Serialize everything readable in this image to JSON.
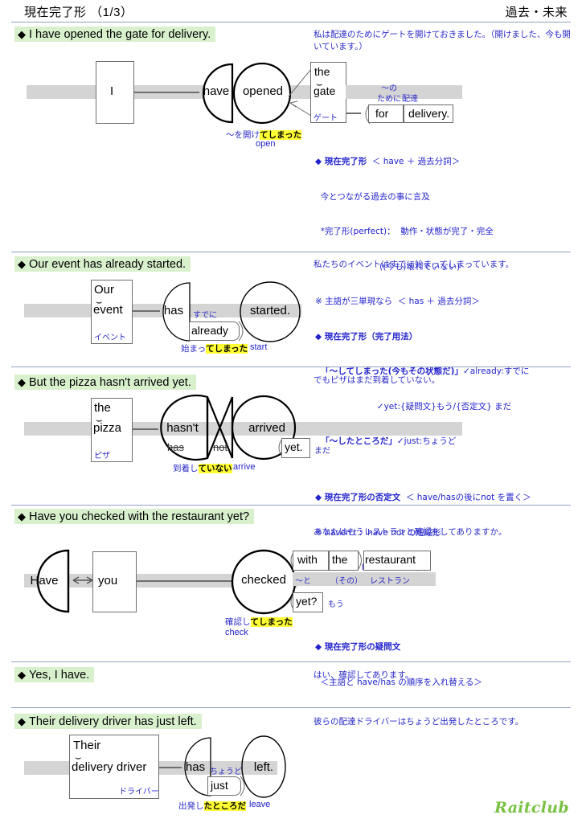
{
  "header": {
    "title": "現在完了形 （1/3）",
    "right": "過去・未来"
  },
  "logo": "Raitclub",
  "sections": [
    {
      "id": "s1",
      "heading": "I have opened the gate for delivery.",
      "diamond": "◆",
      "translation": "私は配達のためにゲートを開けておきました。（開けました、今も開いています。）",
      "diagram": {
        "subject": "I",
        "verb_aux": "have",
        "verb_main": "opened",
        "object_det": "the",
        "object_noun": "gate",
        "object_jp": "ゲート",
        "prep": "for",
        "prep_obj": "delivery.",
        "prep_jp_1": "〜の",
        "prep_jp_2": "ために",
        "prep_jp_3": "配達",
        "ann_jp_plain": "〜を開け",
        "ann_jp_hl": "てしまった",
        "ann_en": "open"
      },
      "explain": [
        {
          "bold": "◆ 現在完了形",
          "rest": "  ＜ have ＋ 過去分詞＞"
        },
        {
          "bold": "",
          "rest": "  今とつながる過去の事に言及"
        },
        {
          "bold": "",
          "rest": "  *完了形(perfect)：  動作・状態が完了・完全"
        },
        {
          "bold": "",
          "rest": "                        ((今も)壊れていない)"
        },
        {
          "bold": "",
          "rest": "※ 主語が三単現なら  ＜ has ＋ 過去分詞＞"
        },
        {
          "bold": "◆ 現在完了形（完了用法）",
          "rest": ""
        },
        {
          "bold": "  「〜してしまった(今もその状態だ)」",
          "rest": "✓already:すでに"
        },
        {
          "bold": "",
          "rest": "                       ✓yet:{疑問文}もう/{否定文} まだ"
        },
        {
          "bold": "  「〜したところだ」",
          "rest": "✓just:ちょうど"
        }
      ]
    },
    {
      "id": "s2",
      "heading": "Our event has already started.",
      "diamond": "◆",
      "translation": "私たちのイベントはすでに始まってしまっています。",
      "diagram": {
        "subject_det": "Our",
        "subject_noun": "event",
        "subject_jp": "イベント",
        "verb_aux": "has",
        "adverb": "already",
        "adverb_jp": "すでに",
        "verb_main": "started.",
        "ann_jp_plain": "始まっ",
        "ann_jp_hl": "てしまった",
        "ann_en": "start"
      },
      "explain": []
    },
    {
      "id": "s3",
      "heading": "But the pizza hasn't arrived yet.",
      "diamond": "◆",
      "translation": "でもピザはまだ到着していない。",
      "diagram": {
        "subject_det": "the",
        "subject_noun": "pizza",
        "subject_jp": "ピザ",
        "verb_aux": "hasn't",
        "verb_aux_expand_1": "has",
        "verb_aux_expand_2": "not",
        "verb_main": "arrived",
        "adverb": "yet.",
        "adverb_jp": "まだ",
        "ann_jp_plain": "到着し",
        "ann_jp_hl": "ていない",
        "ann_en": "arrive"
      },
      "explain": [
        {
          "bold": "◆ 現在完了形の否定文",
          "rest": "  ＜ have/hasの後にnot を置く＞"
        },
        {
          "bold": "",
          "rest": "※ haven't :  have not の短縮形"
        },
        {
          "bold": "",
          "rest": "※ hasn't :  has not の短縮形"
        }
      ]
    },
    {
      "id": "s4",
      "heading": "Have you checked with the restaurant yet?",
      "diamond": "◆",
      "translation": "あなたはもうレストランと確認をしてありますか。",
      "diagram": {
        "verb_aux": "Have",
        "subject": "you",
        "verb_main": "checked",
        "prep": "with",
        "prep_det": "the",
        "prep_noun": "restaurant",
        "prep_jp_1": "〜と",
        "prep_jp_2": "（その）",
        "prep_jp_3": "レストラン",
        "adverb": "yet?",
        "adverb_jp": "もう",
        "ann_jp_plain": "確認し",
        "ann_jp_hl": "てしまった",
        "ann_en": "check"
      },
      "explain": [
        {
          "bold": "◆ 現在完了形の疑問文",
          "rest": ""
        },
        {
          "bold": "",
          "rest": "  ＜主語と have/has の順序を入れ替える＞"
        }
      ]
    },
    {
      "id": "s5",
      "heading": "Yes, I have.",
      "diamond": "◆",
      "translation": "はい、確認してあります。",
      "diagram": null,
      "explain": []
    },
    {
      "id": "s6",
      "heading": "Their delivery driver has just left.",
      "diamond": "◆",
      "translation": "彼らの配達ドライバーはちょうど出発したところです。",
      "diagram": {
        "subject_det": "Their",
        "subject_noun": "delivery driver",
        "subject_jp": "ドライバー",
        "verb_aux": "has",
        "adverb": "just",
        "adverb_jp": "ちょうど",
        "verb_main": "left.",
        "ann_jp_plain": "出発し",
        "ann_jp_hl": "たところだ",
        "ann_en": "leave"
      },
      "explain": []
    }
  ]
}
